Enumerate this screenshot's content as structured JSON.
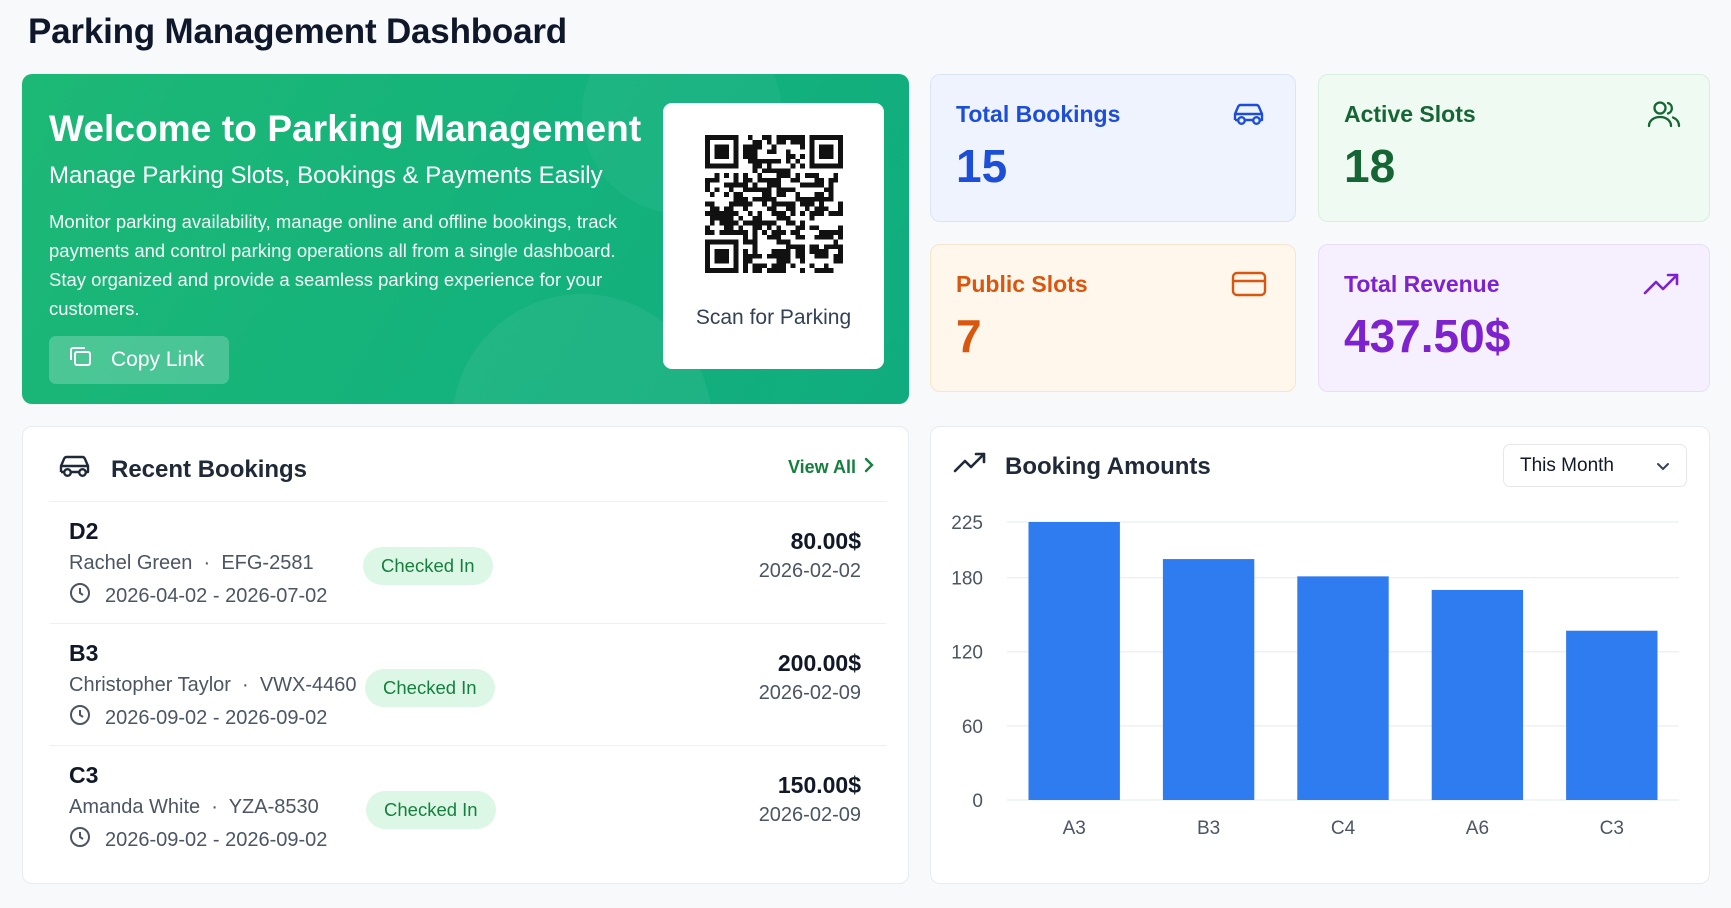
{
  "page_title": "Parking Management Dashboard",
  "hero": {
    "title": "Welcome to Parking Management",
    "subtitle": "Manage Parking Slots, Bookings & Payments Easily",
    "description": "Monitor parking availability, manage online and offline bookings, track payments and control parking operations all from a single dashboard. Stay organized and provide a seamless parking experience for your customers.",
    "copy_link_label": "Copy Link",
    "qr_label": "Scan for Parking"
  },
  "stats": {
    "total_bookings": {
      "label": "Total Bookings",
      "value": "15",
      "icon": "car-icon",
      "color": "#1d4ed8"
    },
    "active_slots": {
      "label": "Active Slots",
      "value": "18",
      "icon": "users-icon",
      "color": "#166534"
    },
    "public_slots": {
      "label": "Public Slots",
      "value": "7",
      "icon": "credit-card-icon",
      "color": "#d9560f"
    },
    "total_revenue": {
      "label": "Total Revenue",
      "value": "437.50$",
      "icon": "trending-up-icon",
      "color": "#7e22ce"
    }
  },
  "recent_bookings": {
    "title": "Recent Bookings",
    "view_all_label": "View All",
    "items": [
      {
        "slot": "D2",
        "name": "Rachel Green",
        "plate": "EFG-2581",
        "dates": "2026-04-02 - 2026-07-02",
        "status": "Checked In",
        "amount": "80.00$",
        "payment_date": "2026-02-02"
      },
      {
        "slot": "B3",
        "name": "Christopher Taylor",
        "plate": "VWX-4460",
        "dates": "2026-09-02 - 2026-09-02",
        "status": "Checked In",
        "amount": "200.00$",
        "payment_date": "2026-02-09"
      },
      {
        "slot": "C3",
        "name": "Amanda White",
        "plate": "YZA-8530",
        "dates": "2026-09-02 - 2026-09-02",
        "status": "Checked In",
        "amount": "150.00$",
        "payment_date": "2026-02-09"
      }
    ]
  },
  "booking_amounts": {
    "title": "Booking Amounts",
    "period_selected": "This Month"
  },
  "chart_data": {
    "type": "bar",
    "categories": [
      "A3",
      "B3",
      "C4",
      "A6",
      "C3"
    ],
    "values": [
      225,
      195,
      181,
      170,
      137
    ],
    "y_ticks": [
      0,
      60,
      120,
      180,
      225
    ],
    "ylim": [
      0,
      225
    ],
    "grid": true,
    "bar_color": "#2f7bf0"
  }
}
